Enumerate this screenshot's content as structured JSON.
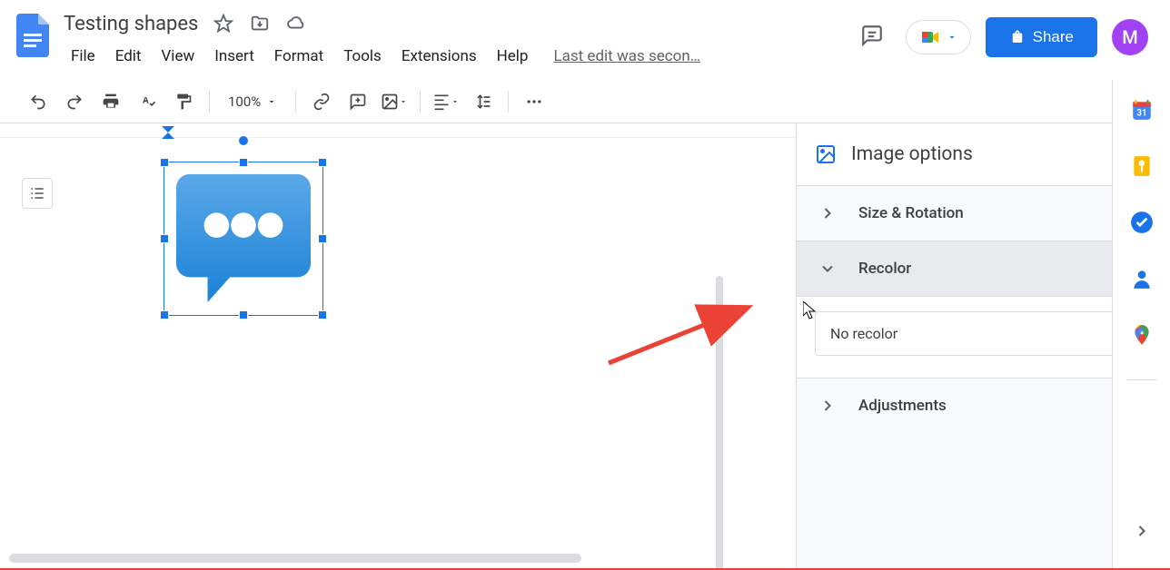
{
  "doc": {
    "title": "Testing shapes"
  },
  "menus": {
    "file": "File",
    "edit": "Edit",
    "view": "View",
    "insert": "Insert",
    "format": "Format",
    "tools": "Tools",
    "extensions": "Extensions",
    "help": "Help"
  },
  "last_edit": "Last edit was secon…",
  "toolbar": {
    "zoom": "100%"
  },
  "header": {
    "share": "Share",
    "avatar_initial": "M"
  },
  "sidebar": {
    "title": "Image options",
    "sections": {
      "size_rotation": "Size & Rotation",
      "recolor": "Recolor",
      "adjustments": "Adjustments"
    },
    "recolor_select": "No recolor"
  },
  "right_panel_icons": {
    "calendar": "31"
  }
}
